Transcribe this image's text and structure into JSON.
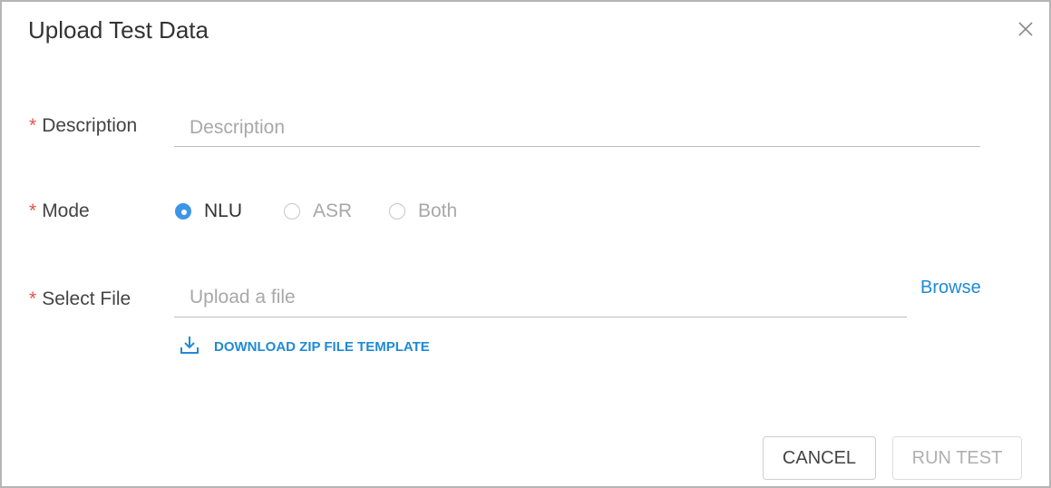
{
  "dialog": {
    "title": "Upload Test Data",
    "close_icon": "close-icon"
  },
  "form": {
    "description": {
      "required_marker": "*",
      "label": "Description",
      "placeholder": "Description",
      "value": ""
    },
    "mode": {
      "required_marker": "*",
      "label": "Mode",
      "options": [
        {
          "label": "NLU",
          "selected": true
        },
        {
          "label": "ASR",
          "selected": false
        },
        {
          "label": "Both",
          "selected": false
        }
      ]
    },
    "file": {
      "required_marker": "*",
      "label": "Select File",
      "placeholder": "Upload a file",
      "value": "",
      "browse_label": "Browse",
      "download_label": "DOWNLOAD ZIP FILE TEMPLATE",
      "download_icon": "download-icon"
    }
  },
  "footer": {
    "cancel_label": "CANCEL",
    "run_label": "RUN TEST"
  },
  "colors": {
    "accent": "#3e95e8",
    "link": "#1f8ad6",
    "required": "#e5534b"
  }
}
